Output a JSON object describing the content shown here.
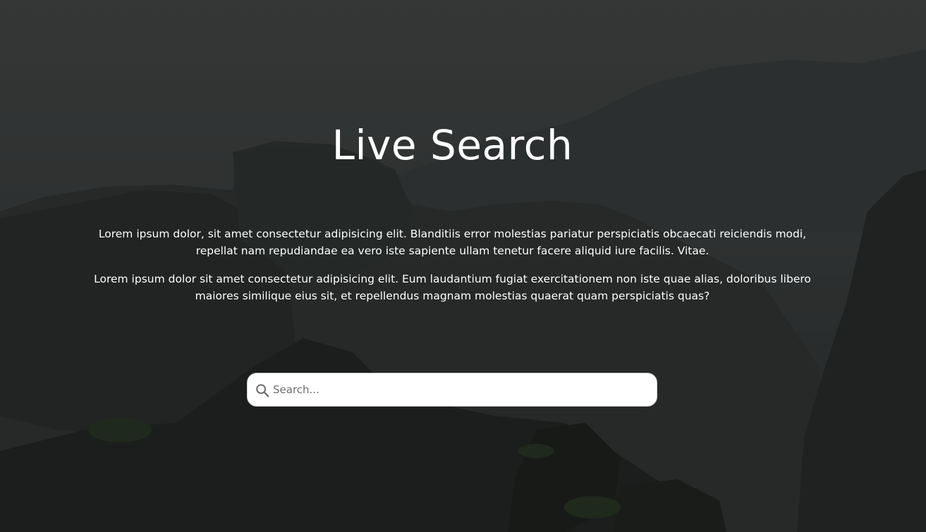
{
  "page": {
    "title": "Live Search",
    "paragraphs": [
      "Lorem ipsum dolor, sit amet consectetur adipisicing elit. Blanditiis error molestias pariatur perspiciatis obcaecati reiciendis modi, repellat nam repudiandae ea vero iste sapiente ullam tenetur facere aliquid iure facilis. Vitae.",
      "Lorem ipsum dolor sit amet consectetur adipisicing elit. Eum laudantium fugiat exercitationem non iste quae alias, doloribus libero maiores similique eius sit, et repellendus magnam molestias quaerat quam perspiciatis quas?"
    ]
  },
  "search": {
    "placeholder": "Search...",
    "value": "",
    "icon": "search-icon"
  },
  "colors": {
    "text": "#ffffff",
    "overlay": "#000000",
    "input_background": "#ffffff"
  }
}
